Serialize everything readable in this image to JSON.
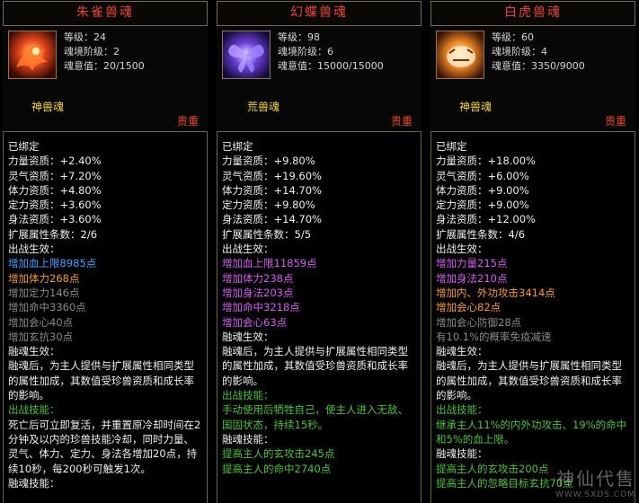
{
  "cards": [
    {
      "title": "朱雀兽魂",
      "icon": "vermilion-bird-icon",
      "stats": [
        "等级：24",
        "魂境阶级：2",
        "魂意值：20/1500"
      ],
      "type": "神兽魂",
      "rarity": "贵重",
      "lines": [
        {
          "text": "已绑定",
          "color": "white"
        },
        {
          "text": "力量资质：+2.40%",
          "color": "white"
        },
        {
          "text": "灵气资质：+7.20%",
          "color": "white"
        },
        {
          "text": "体力资质：+4.80%",
          "color": "white"
        },
        {
          "text": "定力资质：+3.60%",
          "color": "white"
        },
        {
          "text": "身法资质：+3.60%",
          "color": "white"
        },
        {
          "text": "扩展属性条数：2/6",
          "color": "white"
        },
        {
          "text": "出战生效：",
          "color": "white"
        },
        {
          "text": "增加血上限8985点",
          "color": "blue"
        },
        {
          "text": "增加体力268点",
          "color": "orange"
        },
        {
          "text": "增加定力146点",
          "color": "gray"
        },
        {
          "text": "增加命中3360点",
          "color": "gray"
        },
        {
          "text": "增加会心40点",
          "color": "gray"
        },
        {
          "text": "增加玄抗30点",
          "color": "gray"
        },
        {
          "text": "融魂生效：",
          "color": "white"
        },
        {
          "text": "融魂后，为主人提供与扩展属性相同类型的属性加成，其数值受珍兽资质和成长率的影响。",
          "color": "white",
          "wrap": true
        },
        {
          "text": "出战技能：",
          "color": "green"
        },
        {
          "text": "死亡后可立即复活，并重置原冷却时间在2分钟及以内的珍兽技能冷却，同时力量、灵气、体力、定力、身法各增加20点，持续10秒，每200秒可触发1次。",
          "color": "white",
          "wrap": true
        },
        {
          "text": "融魂技能：",
          "color": "white"
        }
      ]
    },
    {
      "title": "幻蝶兽魂",
      "icon": "phantom-butterfly-icon",
      "stats": [
        "等级：98",
        "魂境阶级：6",
        "魂意值：15000/15000"
      ],
      "type": "荒兽魂",
      "rarity": "贵重",
      "lines": [
        {
          "text": "已绑定",
          "color": "white"
        },
        {
          "text": "力量资质：+9.80%",
          "color": "white"
        },
        {
          "text": "灵气资质：+19.60%",
          "color": "white"
        },
        {
          "text": "体力资质：+14.70%",
          "color": "white"
        },
        {
          "text": "定力资质：+9.80%",
          "color": "white"
        },
        {
          "text": "身法资质：+14.70%",
          "color": "white"
        },
        {
          "text": "扩展属性条数：5/5",
          "color": "white"
        },
        {
          "text": "出战生效：",
          "color": "white"
        },
        {
          "text": "增加血上限11859点",
          "color": "purple"
        },
        {
          "text": "增加体力238点",
          "color": "purple"
        },
        {
          "text": "增加身法203点",
          "color": "purple"
        },
        {
          "text": "增加命中3218点",
          "color": "purple"
        },
        {
          "text": "增加会心63点",
          "color": "purple"
        },
        {
          "text": "融魂生效：",
          "color": "white"
        },
        {
          "text": "融魂后，为主人提供与扩展属性相同类型的属性加成，其数值受珍兽资质和成长率的影响。",
          "color": "white",
          "wrap": true
        },
        {
          "text": "出战技能：",
          "color": "green"
        },
        {
          "text": "手动使用后牺牲自己，使主人进入无敌、国固状态，持续15秒。",
          "color": "green",
          "wrap": true
        },
        {
          "text": "融魂技能：",
          "color": "white"
        },
        {
          "text": "提高主人的玄攻击245点",
          "color": "green"
        },
        {
          "text": "提高主人的命中2740点",
          "color": "green"
        }
      ]
    },
    {
      "title": "白虎兽魂",
      "icon": "white-tiger-icon",
      "stats": [
        "等级：60",
        "魂境阶级：4",
        "魂意值：3350/9000"
      ],
      "type": "神兽魂",
      "rarity": "贵重",
      "lines": [
        {
          "text": "已绑定",
          "color": "white"
        },
        {
          "text": "力量资质：+18.00%",
          "color": "white"
        },
        {
          "text": "灵气资质：+6.00%",
          "color": "white"
        },
        {
          "text": "体力资质：+9.00%",
          "color": "white"
        },
        {
          "text": "定力资质：+9.00%",
          "color": "white"
        },
        {
          "text": "身法资质：+12.00%",
          "color": "white"
        },
        {
          "text": "扩展属性条数：4/6",
          "color": "white"
        },
        {
          "text": "出战生效：",
          "color": "white"
        },
        {
          "text": "增加力量215点",
          "color": "purple"
        },
        {
          "text": "增加身法210点",
          "color": "purple"
        },
        {
          "text": "增加内、外功攻击3414点",
          "color": "orange"
        },
        {
          "text": "增加会心82点",
          "color": "orange"
        },
        {
          "text": "增加会心防御28点",
          "color": "gray"
        },
        {
          "text": "有10.1%的概率免疫减速",
          "color": "gray"
        },
        {
          "text": "融魂生效：",
          "color": "white"
        },
        {
          "text": "融魂后，为主人提供与扩展属性相同类型的属性加成，其数值受珍兽资质和成长率的影响。",
          "color": "white",
          "wrap": true
        },
        {
          "text": "出战技能：",
          "color": "green"
        },
        {
          "text": "继承主人11%的内外功攻击、19%的命中和5%的血上限。",
          "color": "green",
          "wrap": true
        },
        {
          "text": "融魂技能：",
          "color": "white"
        },
        {
          "text": "提高主人的玄攻击200点",
          "color": "green"
        },
        {
          "text": "提高主人的忽略目标玄抗70点",
          "color": "green"
        }
      ]
    }
  ],
  "watermark": {
    "main": "神仙代售",
    "sub": "WWW.SXDS.COM"
  }
}
